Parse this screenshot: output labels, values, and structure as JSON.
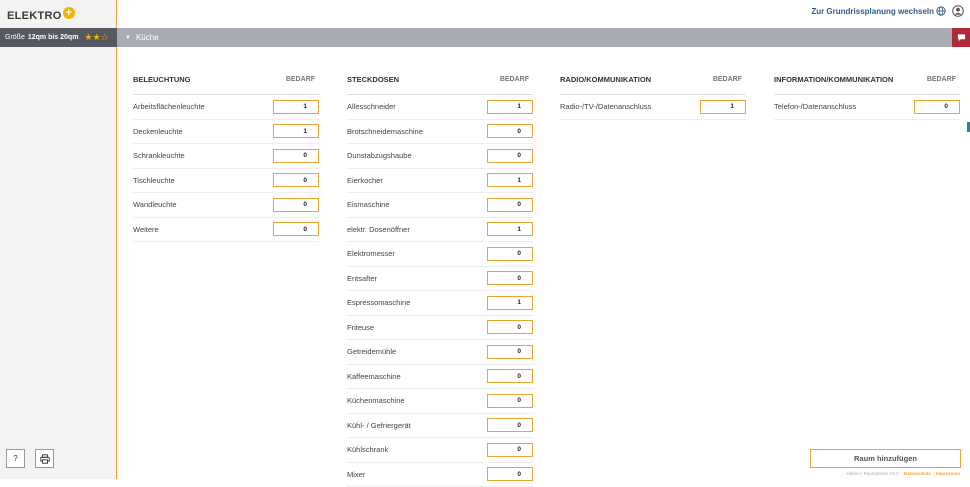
{
  "logo": {
    "text": "ELEKTRO",
    "plus": "+"
  },
  "sidebar": {
    "size_label": "Größe",
    "size_value": "12qm bis 20qm",
    "rating": 2,
    "rating_max": 3,
    "help_label": "?",
    "print_icon": "printer-icon"
  },
  "header": {
    "switch_link": "Zur Grundrissplanung wechseln",
    "globe_icon": "globe-icon",
    "user_icon": "user-icon"
  },
  "room": {
    "name": "Küche",
    "chat_icon": "chat-icon"
  },
  "columns": [
    {
      "title": "BELEUCHTUNG",
      "bedarf": "BEDARF",
      "items": [
        {
          "label": "Arbeitsflächenleuchte",
          "value": "1"
        },
        {
          "label": "Deckenleuchte",
          "value": "1"
        },
        {
          "label": "Schrankleuchte",
          "value": "0"
        },
        {
          "label": "Tischleuchte",
          "value": "0"
        },
        {
          "label": "Wandleuchte",
          "value": "0"
        },
        {
          "label": "Weitere",
          "value": "0"
        }
      ]
    },
    {
      "title": "STECKDOSEN",
      "bedarf": "BEDARF",
      "items": [
        {
          "label": "Allesschneider",
          "value": "1"
        },
        {
          "label": "Brotschneidemaschine",
          "value": "0"
        },
        {
          "label": "Dunstabzugshaube",
          "value": "0"
        },
        {
          "label": "Eierkocher",
          "value": "1"
        },
        {
          "label": "Eismaschine",
          "value": "0"
        },
        {
          "label": "elektr. Dosenöffner",
          "value": "1"
        },
        {
          "label": "Elektromesser",
          "value": "0"
        },
        {
          "label": "Entsafter",
          "value": "0"
        },
        {
          "label": "Espressomaschine",
          "value": "1"
        },
        {
          "label": "Friteuse",
          "value": "0"
        },
        {
          "label": "Getreidemühle",
          "value": "0"
        },
        {
          "label": "Kaffeemaschine",
          "value": "0"
        },
        {
          "label": "Küchenmaschine",
          "value": "0"
        },
        {
          "label": "Kühl- / Gefriergerät",
          "value": "0"
        },
        {
          "label": "Kühlschrank",
          "value": "0"
        },
        {
          "label": "Mixer",
          "value": "0"
        }
      ]
    },
    {
      "title": "RADIO/KOMMUNIKATION",
      "bedarf": "BEDARF",
      "items": [
        {
          "label": "Radio-/TV-/Datenanschluss",
          "value": "1"
        }
      ]
    },
    {
      "title": "INFORMATION/KOMMUNIKATION",
      "bedarf": "BEDARF",
      "items": [
        {
          "label": "Telefon-/Datenanschluss",
          "value": "0"
        }
      ]
    }
  ],
  "actions": {
    "add_room": "Raum hinzufügen"
  },
  "footer": {
    "copyright": "elektro+ Raumplaner V2.0",
    "privacy": "Datenschutz",
    "imprint": "Impressum"
  },
  "colors": {
    "accent": "#e8a435",
    "room_bar": "#a8abb3",
    "chat": "#b0283a",
    "link": "#2d5a8a"
  }
}
